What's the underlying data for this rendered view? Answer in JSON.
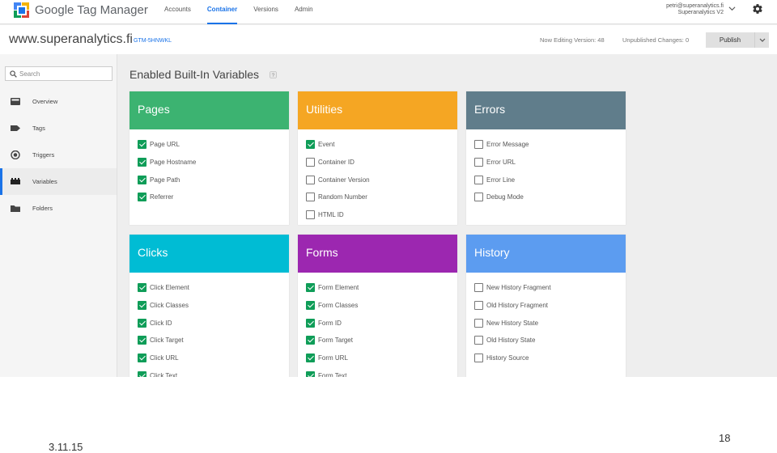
{
  "topbar": {
    "brand": "Google Tag Manager",
    "nav": [
      {
        "label": "Accounts",
        "active": false
      },
      {
        "label": "Container",
        "active": true
      },
      {
        "label": "Versions",
        "active": false
      },
      {
        "label": "Admin",
        "active": false
      }
    ],
    "account_email": "petri@superanalytics.fi",
    "account_name": "Superanalytics V2"
  },
  "container": {
    "site": "www.superanalytics.fi",
    "id": "GTM-5HNWKL",
    "version": "Now Editing Version: 48",
    "unpublished": "Unpublished Changes: 0",
    "publish_label": "Publish"
  },
  "sidebar": {
    "search_placeholder": "Search",
    "items": [
      {
        "label": "Overview",
        "icon": "overview-icon",
        "active": false
      },
      {
        "label": "Tags",
        "icon": "tag-icon",
        "active": false
      },
      {
        "label": "Triggers",
        "icon": "trigger-icon",
        "active": false
      },
      {
        "label": "Variables",
        "icon": "variables-icon",
        "active": true
      },
      {
        "label": "Folders",
        "icon": "folder-icon",
        "active": false
      }
    ]
  },
  "main": {
    "title": "Enabled Built-In Variables",
    "cards": [
      {
        "title": "Pages",
        "color": "#3cb371",
        "items": [
          {
            "label": "Page URL",
            "checked": true
          },
          {
            "label": "Page Hostname",
            "checked": true
          },
          {
            "label": "Page Path",
            "checked": true
          },
          {
            "label": "Referrer",
            "checked": true
          }
        ]
      },
      {
        "title": "Utilities",
        "color": "#f5a623",
        "items": [
          {
            "label": "Event",
            "checked": true
          },
          {
            "label": "Container ID",
            "checked": false
          },
          {
            "label": "Container Version",
            "checked": false
          },
          {
            "label": "Random Number",
            "checked": false
          },
          {
            "label": "HTML ID",
            "checked": false
          }
        ]
      },
      {
        "title": "Errors",
        "color": "#607d8b",
        "items": [
          {
            "label": "Error Message",
            "checked": false
          },
          {
            "label": "Error URL",
            "checked": false
          },
          {
            "label": "Error Line",
            "checked": false
          },
          {
            "label": "Debug Mode",
            "checked": false
          }
        ]
      },
      {
        "title": "Clicks",
        "color": "#00bcd4",
        "items": [
          {
            "label": "Click Element",
            "checked": true
          },
          {
            "label": "Click Classes",
            "checked": true
          },
          {
            "label": "Click ID",
            "checked": true
          },
          {
            "label": "Click Target",
            "checked": true
          },
          {
            "label": "Click URL",
            "checked": true
          },
          {
            "label": "Click Text",
            "checked": true
          }
        ]
      },
      {
        "title": "Forms",
        "color": "#9c27b0",
        "items": [
          {
            "label": "Form Element",
            "checked": true
          },
          {
            "label": "Form Classes",
            "checked": true
          },
          {
            "label": "Form ID",
            "checked": true
          },
          {
            "label": "Form Target",
            "checked": true
          },
          {
            "label": "Form URL",
            "checked": true
          },
          {
            "label": "Form Text",
            "checked": true
          }
        ]
      },
      {
        "title": "History",
        "color": "#5c9cf0",
        "items": [
          {
            "label": "New History Fragment",
            "checked": false
          },
          {
            "label": "Old History Fragment",
            "checked": false
          },
          {
            "label": "New History State",
            "checked": false
          },
          {
            "label": "Old History State",
            "checked": false
          },
          {
            "label": "History Source",
            "checked": false
          }
        ]
      }
    ]
  },
  "footer": {
    "date": "3.11.15",
    "page_number": "18"
  }
}
